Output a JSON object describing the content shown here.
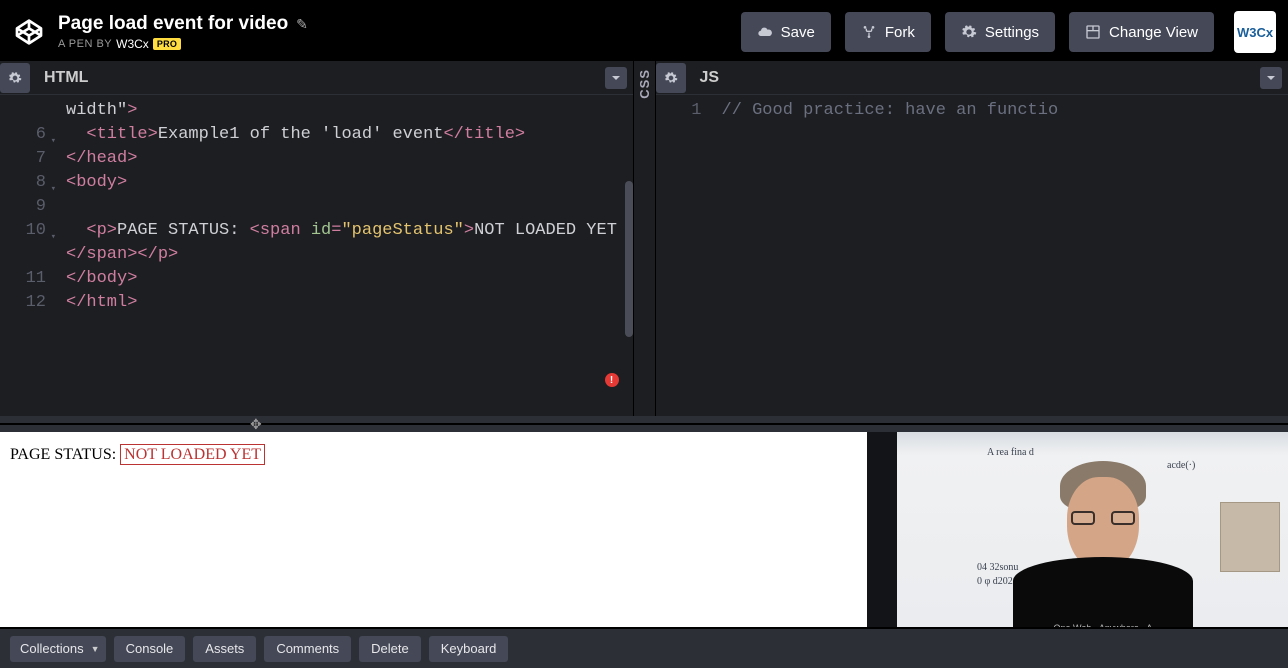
{
  "header": {
    "title": "Page load event for video",
    "subtitle_prefix": "A PEN BY",
    "author": "W3Cx",
    "pro_badge": "PRO",
    "buttons": {
      "save": "Save",
      "fork": "Fork",
      "settings": "Settings",
      "change_view": "Change View"
    },
    "avatar_text": "W3Cx"
  },
  "panels": {
    "html_title": "HTML",
    "css_title": "CSS",
    "js_title": "JS"
  },
  "html_code": {
    "line_numbers": [
      "",
      "6",
      "7",
      "8",
      "9",
      "10",
      "11",
      "12"
    ],
    "lines": [
      {
        "parts": [
          {
            "c": "t-text",
            "t": "width\""
          },
          {
            "c": "t-tag",
            "t": ">"
          }
        ]
      },
      {
        "parts": [
          {
            "c": "t-text",
            "t": "  "
          },
          {
            "c": "t-tag",
            "t": "<title>"
          },
          {
            "c": "t-text",
            "t": "Example1 of the 'load' event"
          },
          {
            "c": "t-tag",
            "t": "</title>"
          }
        ]
      },
      {
        "parts": [
          {
            "c": "t-tag",
            "t": "</head>"
          }
        ]
      },
      {
        "parts": [
          {
            "c": "t-tag",
            "t": "<body>"
          }
        ]
      },
      {
        "parts": []
      },
      {
        "parts": [
          {
            "c": "t-text",
            "t": "  "
          },
          {
            "c": "t-tag",
            "t": "<p>"
          },
          {
            "c": "t-text",
            "t": "PAGE STATUS: "
          },
          {
            "c": "t-tag",
            "t": "<span"
          },
          {
            "c": "t-text",
            "t": " "
          },
          {
            "c": "t-attr",
            "t": "id"
          },
          {
            "c": "t-tag",
            "t": "="
          },
          {
            "c": "t-str",
            "t": "\"pageStatus\""
          },
          {
            "c": "t-tag",
            "t": ">"
          },
          {
            "c": "t-text",
            "t": "NOT LOADED YET"
          },
          {
            "c": "t-tag",
            "t": "</span></p>"
          }
        ]
      },
      {
        "parts": [
          {
            "c": "t-tag",
            "t": "</body>"
          }
        ]
      },
      {
        "parts": [
          {
            "c": "t-tag",
            "t": "</html>"
          }
        ]
      }
    ],
    "error_badge": "!"
  },
  "js_code": {
    "line_numbers": [
      "1"
    ],
    "lines": [
      {
        "parts": [
          {
            "c": "t-comment",
            "t": "// Good practice: have an functio"
          }
        ]
      }
    ]
  },
  "preview": {
    "label": "PAGE STATUS: ",
    "status": "NOT LOADED YET"
  },
  "video": {
    "shirt_text": ". One Web · Anywhere · A.."
  },
  "footer": {
    "collections": "Collections",
    "console": "Console",
    "assets": "Assets",
    "comments": "Comments",
    "delete": "Delete",
    "keyboard": "Keyboard"
  }
}
